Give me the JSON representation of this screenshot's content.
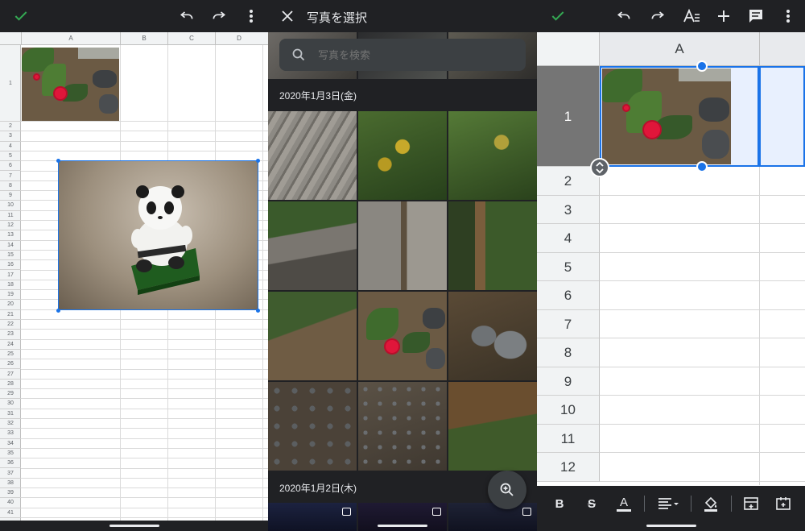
{
  "panel_left": {
    "toolbar": {
      "check_icon": "check-icon",
      "undo_icon": "undo-icon",
      "redo_icon": "redo-icon",
      "more_icon": "more-vert-icon"
    },
    "columns": [
      "A",
      "B",
      "C",
      "D"
    ],
    "rows": [
      "1",
      "2",
      "3",
      "4",
      "5",
      "6",
      "7",
      "8",
      "9",
      "10",
      "11",
      "12",
      "13",
      "14",
      "15",
      "16",
      "17",
      "18",
      "19",
      "20",
      "21",
      "22",
      "23",
      "24",
      "25",
      "26",
      "27",
      "28",
      "29",
      "30",
      "31",
      "32",
      "33",
      "34",
      "35",
      "36",
      "37",
      "38",
      "39",
      "40",
      "41"
    ]
  },
  "panel_middle": {
    "title": "写真を選択",
    "close_icon": "close-icon",
    "search": {
      "placeholder": "写真を検索"
    },
    "date_group_1": "2020年1月3日(金)",
    "date_group_2": "2020年1月2日(木)",
    "zoom_icon": "zoom-in-icon"
  },
  "panel_right": {
    "toolbar": {
      "check_icon": "check-icon",
      "undo_icon": "undo-icon",
      "redo_icon": "redo-icon",
      "text_format_icon": "text-format-icon",
      "add_icon": "add-icon",
      "comment_icon": "comment-icon",
      "more_icon": "more-vert-icon"
    },
    "column_header": "A",
    "rows": [
      "1",
      "2",
      "3",
      "4",
      "5",
      "6",
      "7",
      "8",
      "9",
      "10",
      "11",
      "12"
    ],
    "format_bar": {
      "bold": "B",
      "strikethrough": "S",
      "text_color": "A"
    }
  },
  "colors": {
    "dark": "#202124",
    "selection": "#1a73e8",
    "flower": "#e0163a"
  }
}
